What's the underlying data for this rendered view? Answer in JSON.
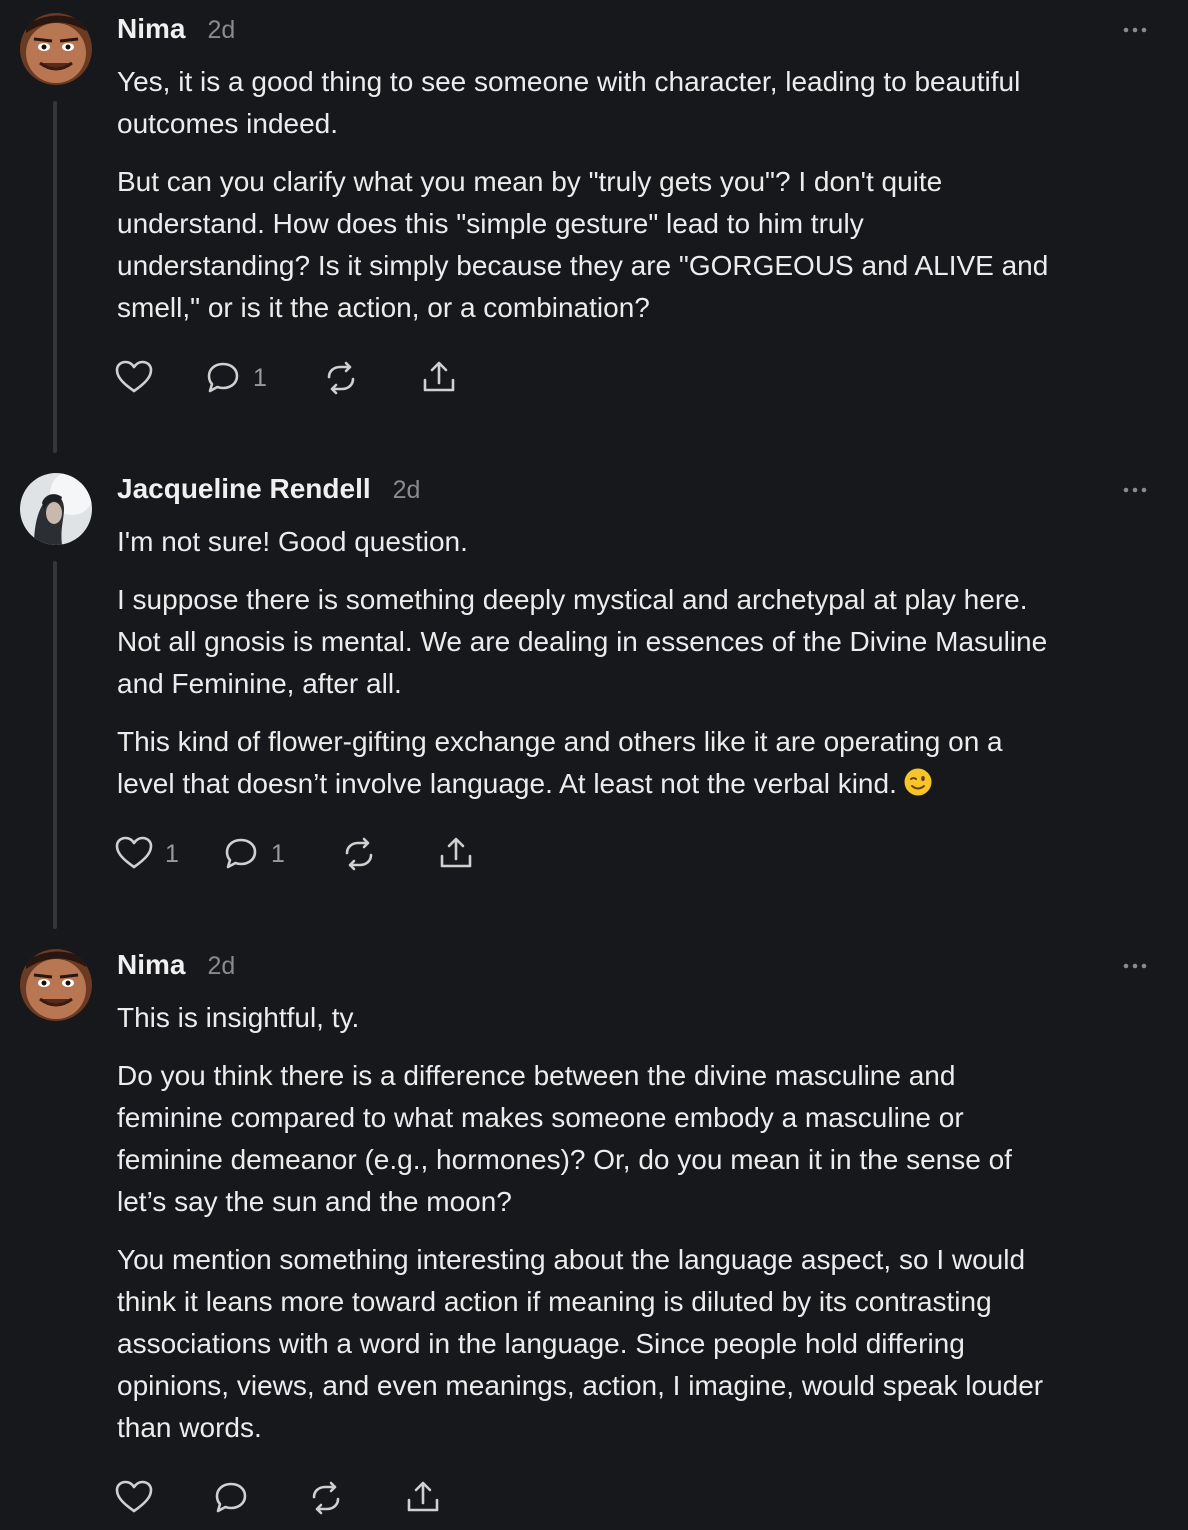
{
  "comments": [
    {
      "author": "Nima",
      "time": "2d",
      "avatar_icon": "avatar-face-icon",
      "paragraphs": [
        [
          "Yes, it is a good thing to see someone with character, leading to beautiful",
          "outcomes indeed."
        ],
        [
          "But can you clarify what you mean by \"truly gets you\"? I don't quite",
          "understand. How does this \"simple gesture\" lead to him truly",
          "understanding? Is it simply because they are \"GORGEOUS and ALIVE and",
          "smell,\" or is it the action, or a combination?"
        ]
      ],
      "like_count": "",
      "reply_count": "1"
    },
    {
      "author": "Jacqueline Rendell",
      "time": "2d",
      "avatar_icon": "avatar-portrait-icon",
      "paragraphs": [
        [
          "I'm not sure! Good question."
        ],
        [
          "I suppose there is something deeply mystical and archetypal at play here.",
          "Not all gnosis is mental. We are dealing in essences of the Divine Masuline",
          "and Feminine, after all."
        ],
        [
          "This kind of flower-gifting exchange and others like it are operating on a",
          "level that doesn’t involve language. At least not the verbal kind."
        ]
      ],
      "emoji": "winking-face-emoji",
      "like_count": "1",
      "reply_count": "1"
    },
    {
      "author": "Nima",
      "time": "2d",
      "avatar_icon": "avatar-face-icon",
      "paragraphs": [
        [
          "This is insightful, ty."
        ],
        [
          "Do you think there is a difference between the divine masculine and",
          "feminine compared to what makes someone embody a masculine or",
          "feminine demeanor (e.g., hormones)? Or, do you mean it in the sense of",
          "let’s say the sun and the moon?"
        ],
        [
          "You mention something interesting about the language aspect, so I would",
          "think it leans more toward action if meaning is diluted by its contrasting",
          "associations with a word in the language. Since people hold differing",
          "opinions, views, and even meanings, action, I imagine, would speak louder",
          "than words."
        ]
      ],
      "like_count": "",
      "reply_count": ""
    }
  ],
  "colors": {
    "background": "#17181b",
    "text": "#ececec",
    "muted": "#8a8a8e",
    "icon": "#d0d0d0",
    "thread_line": "#35363a"
  }
}
